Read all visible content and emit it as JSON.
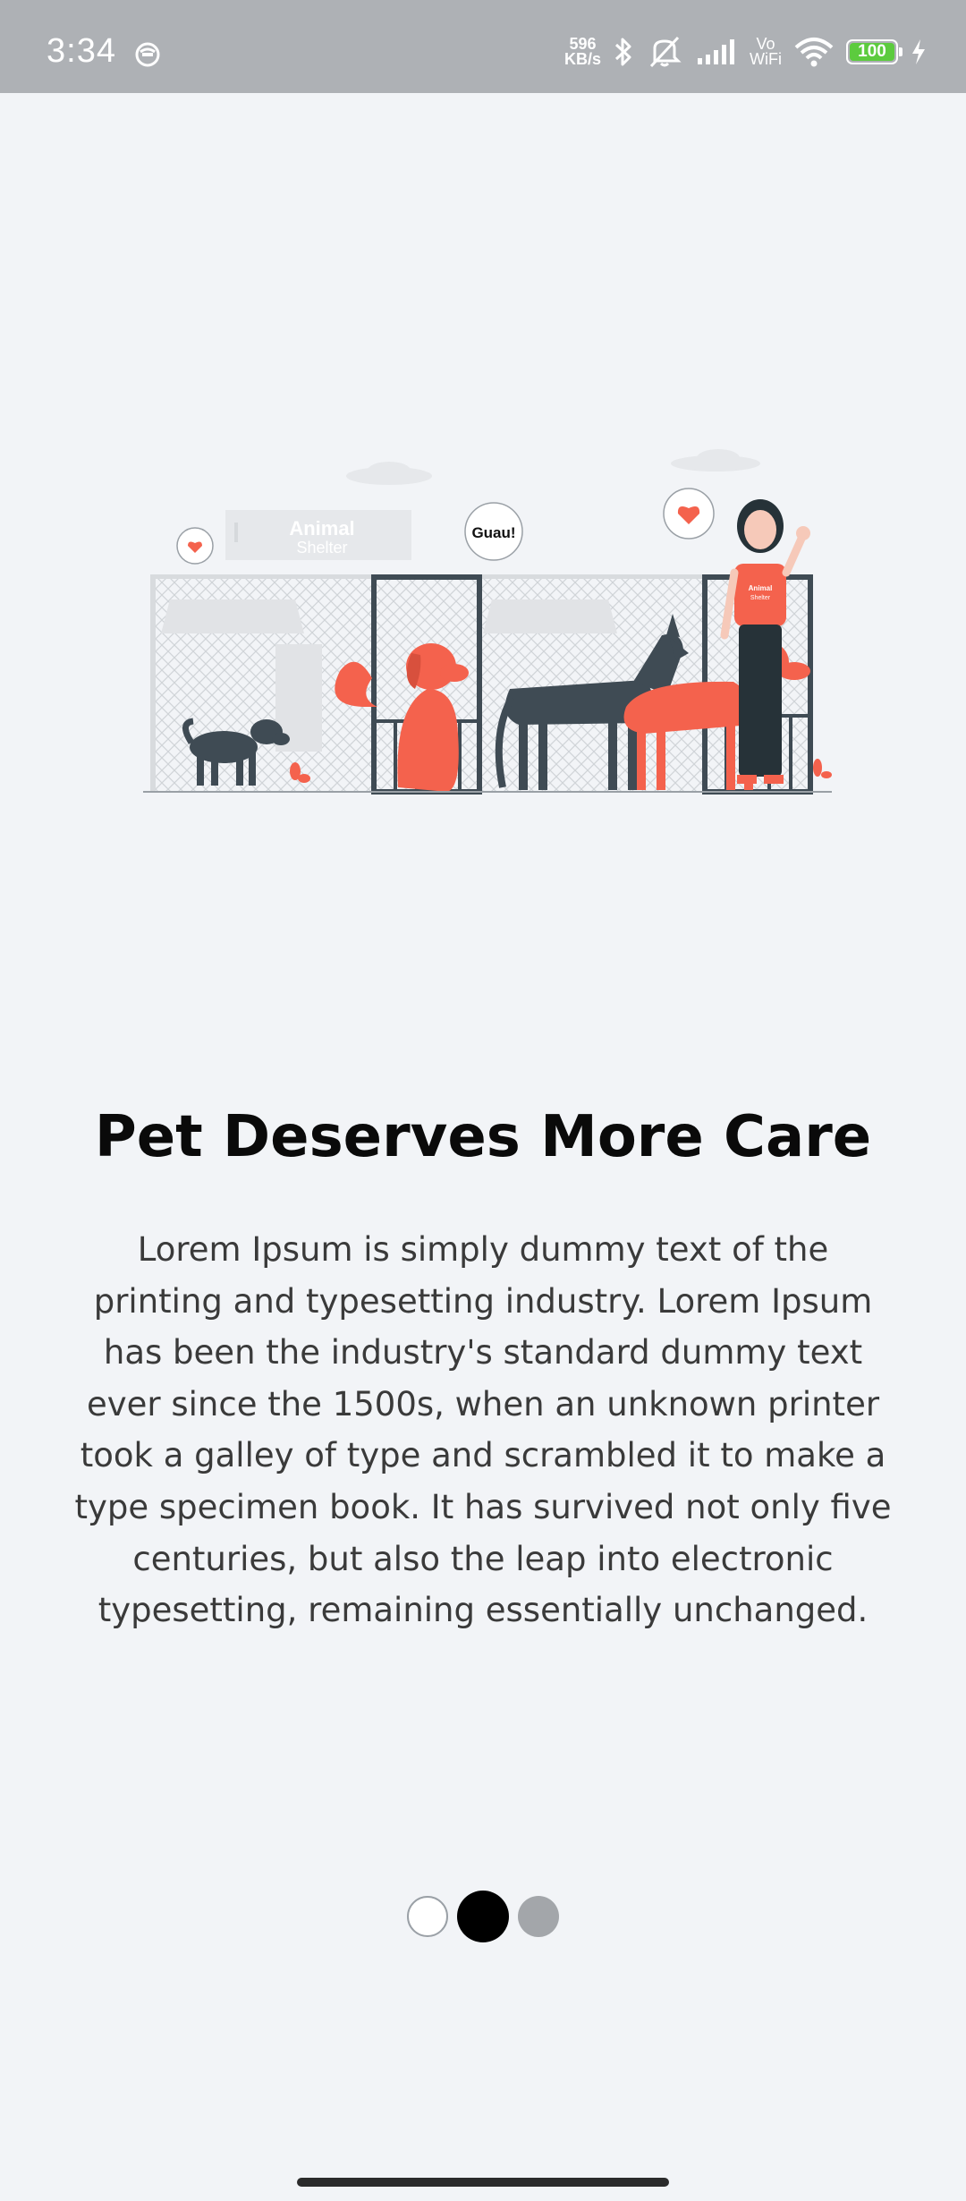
{
  "status_bar": {
    "time": "3:34",
    "net_speed_value": "596",
    "net_speed_unit": "KB/s",
    "vowifi_top": "Vo",
    "vowifi_bottom": "WiFi",
    "battery": "100"
  },
  "illustration": {
    "sign_line1": "Animal",
    "sign_line2": "Shelter",
    "speech_bubble": "Guau!",
    "shirt_line1": "Animal",
    "shirt_line2": "Shelter"
  },
  "onboarding": {
    "title": "Pet Deserves More Care",
    "description": "Lorem Ipsum is simply dummy text of the printing and typesetting industry. Lorem Ipsum has been the industry's standard dummy text ever since the 1500s, when an unknown printer took a galley of type and scrambled it to make a type specimen book. It has survived not only five centuries, but also the leap into electronic typesetting, remaining essentially unchanged.",
    "page_indicator": {
      "total_pages": 3,
      "current_page": 2
    }
  },
  "colors": {
    "accent": "#f4624d",
    "dark": "#3f4b54",
    "background": "#f2f4f7"
  }
}
